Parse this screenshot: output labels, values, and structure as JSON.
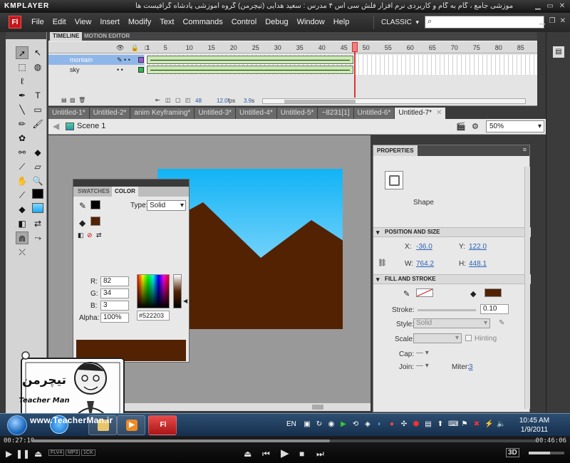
{
  "player": {
    "logo": "KMPLAYER",
    "caption": "مجموعه آموزشی جامع ، گام به گام و کاربردی نرم افزار فلش سی اس ۴ مدرس : سعید هدایی (تیچرمن) گروه آموزشی پادشاه گرافیست ها",
    "time_elapsed": "00:27:10",
    "time_total": "00:46:06",
    "progress": 0.59,
    "badges": [
      "FLV4",
      "MP3",
      "1CK"
    ],
    "three_d": "3D"
  },
  "menubar": {
    "logo": "Fl",
    "items": [
      "File",
      "Edit",
      "View",
      "Insert",
      "Modify",
      "Text",
      "Commands",
      "Control",
      "Debug",
      "Window",
      "Help"
    ],
    "workspace": "CLASSIC",
    "search_placeholder": ""
  },
  "timeline": {
    "tabs": [
      "TIMELINE",
      "MOTION EDITOR"
    ],
    "frame_numbers": [
      "1",
      "5",
      "10",
      "15",
      "20",
      "25",
      "30",
      "35",
      "40",
      "45",
      "50",
      "55",
      "60",
      "65",
      "70",
      "75",
      "80",
      "85"
    ],
    "layers": [
      {
        "name": "montain",
        "selected": true,
        "color": "#9b59d6"
      },
      {
        "name": "sky",
        "selected": false,
        "color": "#2fb84a"
      }
    ],
    "current_frame": "48",
    "fps": "12.0",
    "fps_unit": "fps",
    "elapsed": "3.9",
    "elapsed_unit": "s"
  },
  "doc_tabs": [
    "Untitled-1*",
    "Untitled-2*",
    "anim Keyframing*",
    "Untitled-3*",
    "Untitled-4*",
    "Untitled-5*",
    "~8231[1]",
    "Untitled-6*",
    "Untitled-7*"
  ],
  "editbar": {
    "scene": "Scene 1",
    "zoom": "50%"
  },
  "stage": {
    "sky_top": "#11b3f5",
    "sky_bottom": "#bfeaff",
    "mountain_color": "#522203",
    "pasteboard": "#999999"
  },
  "color_panel": {
    "tabs": [
      "SWATCHES",
      "COLOR"
    ],
    "type_label": "Type:",
    "type_value": "Solid",
    "r_label": "R:",
    "r": "82",
    "g_label": "G:",
    "g": "34",
    "b_label": "B:",
    "b": "3",
    "alpha_label": "Alpha:",
    "alpha": "100%",
    "hex": "#522203",
    "fill_color": "#522203"
  },
  "properties": {
    "tab": "PROPERTIES",
    "object_type": "Shape",
    "pos_section": "POSITION AND SIZE",
    "x_label": "X:",
    "x": "-36.0",
    "y_label": "Y:",
    "y": "122.0",
    "w_label": "W:",
    "w": "764.2",
    "h_label": "H:",
    "h": "448.1",
    "fill_section": "FILL AND STROKE",
    "stroke_label": "Stroke:",
    "stroke_value": "0.10",
    "style_label": "Style:",
    "style_value": "Solid",
    "scale_label": "Scale:",
    "hinting_label": "Hinting",
    "cap_label": "Cap:",
    "join_label": "Join:",
    "miter_label": "Miter:",
    "miter_value": "3",
    "fill_color": "#522203"
  },
  "watermark": {
    "name_fa": "تیچرمن",
    "name_en": "Teacher Man",
    "url": "www.TeacherMan.ir"
  },
  "taskbar": {
    "lang": "EN",
    "time": "10:45 AM",
    "date": "1/9/2011",
    "apps": [
      "ie-icon",
      "folder-icon",
      "media-player-icon",
      "flash-icon"
    ]
  }
}
